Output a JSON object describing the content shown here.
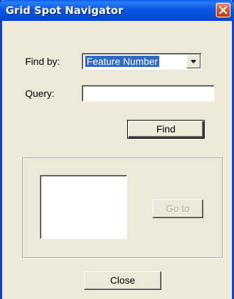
{
  "window": {
    "title": "Grid Spot Navigator",
    "close_icon": "close-icon"
  },
  "form": {
    "find_by_label": "Find by:",
    "find_by_value": "Feature Number",
    "query_label": "Query:",
    "query_value": "",
    "query_placeholder": "",
    "find_button": "Find"
  },
  "results": {
    "items": [],
    "goto_button": "Go to",
    "goto_enabled": false
  },
  "footer": {
    "close_button": "Close"
  },
  "colors": {
    "titlebar": "#0a58e2",
    "face": "#ece9d8",
    "selection": "#316ac5",
    "close_button": "#d9542c"
  }
}
